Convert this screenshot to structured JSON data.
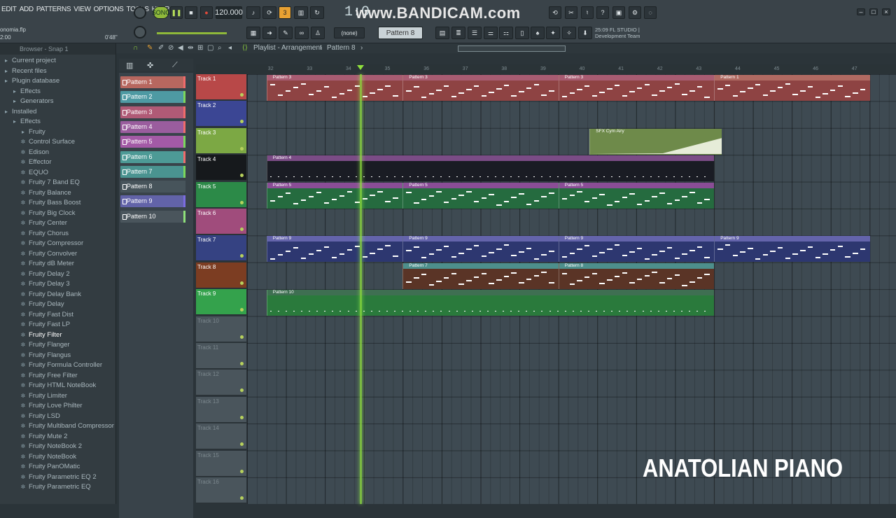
{
  "menu": [
    "EDIT",
    "ADD",
    "PATTERNS",
    "VIEW",
    "OPTIONS",
    "TOOLS",
    "HELP"
  ],
  "transport": {
    "mode": "SONG",
    "tempo": "120.000",
    "time": "1:0"
  },
  "recording_watermark": "www.BANDICAM.com",
  "project": {
    "file": "onomia.flp",
    "time_left": "2:00",
    "time_right": "0'48\""
  },
  "toolbar": {
    "snap": "(none)",
    "pattern": "Pattern 8",
    "hint_line1": "25:09  FL STUDIO |",
    "hint_line2": "Development Team"
  },
  "sidebar": {
    "header": "Browser - Snap 1",
    "items": [
      {
        "label": "Current project",
        "icon": "folder-icon",
        "indent": 0
      },
      {
        "label": "Recent files",
        "icon": "folder-icon",
        "indent": 0
      },
      {
        "label": "Plugin database",
        "icon": "folder-icon",
        "indent": 0
      },
      {
        "label": "Effects",
        "icon": "folder-icon",
        "indent": 1
      },
      {
        "label": "Generators",
        "icon": "folder-icon",
        "indent": 1
      },
      {
        "label": "Installed",
        "icon": "folder-icon",
        "indent": 0
      },
      {
        "label": "Effects",
        "icon": "folder-icon",
        "indent": 1
      },
      {
        "label": "Fruity",
        "icon": "folder-icon",
        "indent": 2
      },
      {
        "label": "Control Surface",
        "icon": "plugin-icon",
        "indent": 2
      },
      {
        "label": "Edison",
        "icon": "plugin-icon",
        "indent": 2
      },
      {
        "label": "Effector",
        "icon": "plugin-icon",
        "indent": 2
      },
      {
        "label": "EQUO",
        "icon": "plugin-icon",
        "indent": 2
      },
      {
        "label": "Fruity 7 Band EQ",
        "icon": "plugin-icon",
        "indent": 2
      },
      {
        "label": "Fruity Balance",
        "icon": "plugin-icon",
        "indent": 2
      },
      {
        "label": "Fruity Bass Boost",
        "icon": "plugin-icon",
        "indent": 2
      },
      {
        "label": "Fruity Big Clock",
        "icon": "plugin-icon",
        "indent": 2
      },
      {
        "label": "Fruity Center",
        "icon": "plugin-icon",
        "indent": 2
      },
      {
        "label": "Fruity Chorus",
        "icon": "plugin-icon",
        "indent": 2
      },
      {
        "label": "Fruity Compressor",
        "icon": "plugin-icon",
        "indent": 2
      },
      {
        "label": "Fruity Convolver",
        "icon": "plugin-icon",
        "indent": 2
      },
      {
        "label": "Fruity dB Meter",
        "icon": "plugin-icon",
        "indent": 2
      },
      {
        "label": "Fruity Delay 2",
        "icon": "plugin-icon",
        "indent": 2
      },
      {
        "label": "Fruity Delay 3",
        "icon": "plugin-icon",
        "indent": 2
      },
      {
        "label": "Fruity Delay Bank",
        "icon": "plugin-icon",
        "indent": 2
      },
      {
        "label": "Fruity Delay",
        "icon": "plugin-icon",
        "indent": 2
      },
      {
        "label": "Fruity Fast Dist",
        "icon": "plugin-icon",
        "indent": 2
      },
      {
        "label": "Fruity Fast LP",
        "icon": "plugin-icon",
        "indent": 2
      },
      {
        "label": "Fruity Filter",
        "icon": "plugin-icon",
        "indent": 2,
        "selected": true
      },
      {
        "label": "Fruity Flanger",
        "icon": "plugin-icon",
        "indent": 2
      },
      {
        "label": "Fruity Flangus",
        "icon": "plugin-icon",
        "indent": 2
      },
      {
        "label": "Fruity Formula Controller",
        "icon": "plugin-icon",
        "indent": 2
      },
      {
        "label": "Fruity Free Filter",
        "icon": "plugin-icon",
        "indent": 2
      },
      {
        "label": "Fruity HTML NoteBook",
        "icon": "plugin-icon",
        "indent": 2
      },
      {
        "label": "Fruity Limiter",
        "icon": "plugin-icon",
        "indent": 2
      },
      {
        "label": "Fruity Love Philter",
        "icon": "plugin-icon",
        "indent": 2
      },
      {
        "label": "Fruity LSD",
        "icon": "plugin-icon",
        "indent": 2
      },
      {
        "label": "Fruity Multiband Compressor",
        "icon": "plugin-icon",
        "indent": 2
      },
      {
        "label": "Fruity Mute 2",
        "icon": "plugin-icon",
        "indent": 2
      },
      {
        "label": "Fruity NoteBook 2",
        "icon": "plugin-icon",
        "indent": 2
      },
      {
        "label": "Fruity NoteBook",
        "icon": "plugin-icon",
        "indent": 2
      },
      {
        "label": "Fruity PanOMatic",
        "icon": "plugin-icon",
        "indent": 2
      },
      {
        "label": "Fruity Parametric EQ 2",
        "icon": "plugin-icon",
        "indent": 2
      },
      {
        "label": "Fruity Parametric EQ",
        "icon": "plugin-icon",
        "indent": 2
      }
    ]
  },
  "playlist": {
    "title": "Playlist - Arrangement",
    "current_pattern": "Pattern 8",
    "ruler": [
      "32",
      "33",
      "34",
      "35",
      "36",
      "37",
      "38",
      "39",
      "40",
      "41",
      "42",
      "43",
      "44",
      "45",
      "46",
      "47"
    ],
    "patterns": [
      {
        "name": "Pattern 1",
        "color": "#b7675f"
      },
      {
        "name": "Pattern 2",
        "color": "#4e9aa3"
      },
      {
        "name": "Pattern 3",
        "color": "#b05a76"
      },
      {
        "name": "Pattern 4",
        "color": "#9a5d9e"
      },
      {
        "name": "Pattern 5",
        "color": "#a35aa6"
      },
      {
        "name": "Pattern 6",
        "color": "#4d9a96"
      },
      {
        "name": "Pattern 7",
        "color": "#4a9390"
      },
      {
        "name": "Pattern 8",
        "color": "#47545b"
      },
      {
        "name": "Pattern 9",
        "color": "#6263a8"
      },
      {
        "name": "Pattern 10",
        "color": "#4a555c"
      }
    ],
    "tracks": [
      {
        "name": "Track 1",
        "color": "#b84848"
      },
      {
        "name": "Track 2",
        "color": "#3b4694"
      },
      {
        "name": "Track 3",
        "color": "#7ca844"
      },
      {
        "name": "Track 4",
        "color": "#16191c"
      },
      {
        "name": "Track 5",
        "color": "#2c8a48"
      },
      {
        "name": "Track 6",
        "color": "#a04c7c"
      },
      {
        "name": "Track 7",
        "color": "#354282"
      },
      {
        "name": "Track 8",
        "color": "#7c3d22"
      },
      {
        "name": "Track 9",
        "color": "#34a24c"
      },
      {
        "name": "Track 10",
        "color": "#4a555c"
      },
      {
        "name": "Track 11",
        "color": "#4a555c"
      },
      {
        "name": "Track 12",
        "color": "#4a555c"
      },
      {
        "name": "Track 13",
        "color": "#4a555c"
      },
      {
        "name": "Track 14",
        "color": "#4a555c"
      },
      {
        "name": "Track 15",
        "color": "#4a555c"
      },
      {
        "name": "Track 16",
        "color": "#4a555c"
      }
    ],
    "clips": [
      {
        "track": 0,
        "start": 32,
        "len": 3.5,
        "label": "Pattern 3",
        "color": "#8e4343",
        "head": "#a85c72"
      },
      {
        "track": 0,
        "start": 35.5,
        "len": 4,
        "label": "Pattern 3",
        "color": "#8e4343",
        "head": "#a85c72"
      },
      {
        "track": 0,
        "start": 39.5,
        "len": 4,
        "label": "Pattern 3",
        "color": "#8e4343",
        "head": "#a85c72"
      },
      {
        "track": 0,
        "start": 43.5,
        "len": 4,
        "label": "Pattern 1",
        "color": "#8e4343",
        "head": "#b06a62"
      },
      {
        "track": 2,
        "start": 40.3,
        "len": 3.4,
        "label": "SFX Cym Airy",
        "color": "#6e8a4a",
        "head": "#6e8a4a"
      },
      {
        "track": 3,
        "start": 32,
        "len": 11.5,
        "label": "Pattern 4",
        "color": "#1a1c24",
        "head": "#7b4c86"
      },
      {
        "track": 4,
        "start": 32,
        "len": 3.5,
        "label": "Pattern 5",
        "color": "#256b3f",
        "head": "#8a4d96"
      },
      {
        "track": 4,
        "start": 35.5,
        "len": 4,
        "label": "Pattern 5",
        "color": "#256b3f",
        "head": "#8a4d96"
      },
      {
        "track": 4,
        "start": 39.5,
        "len": 4,
        "label": "Pattern 5",
        "color": "#256b3f",
        "head": "#8a4d96"
      },
      {
        "track": 6,
        "start": 32,
        "len": 3.5,
        "label": "Pattern 9",
        "color": "#2d3770",
        "head": "#6464ab"
      },
      {
        "track": 6,
        "start": 35.5,
        "len": 4,
        "label": "Pattern 9",
        "color": "#2d3770",
        "head": "#6464ab"
      },
      {
        "track": 6,
        "start": 39.5,
        "len": 4,
        "label": "Pattern 9",
        "color": "#2d3770",
        "head": "#6464ab"
      },
      {
        "track": 6,
        "start": 43.5,
        "len": 4,
        "label": "Pattern 9",
        "color": "#2d3770",
        "head": "#6464ab"
      },
      {
        "track": 7,
        "start": 35.5,
        "len": 4,
        "label": "Pattern 7",
        "color": "#5a3426",
        "head": "#4d8f8c"
      },
      {
        "track": 7,
        "start": 39.5,
        "len": 4,
        "label": "Pattern 8",
        "color": "#5a3426",
        "head": "#4d8f8c"
      },
      {
        "track": 8,
        "start": 32,
        "len": 11.5,
        "label": "Pattern 10",
        "color": "#2a7a3c",
        "head": "#3f6f52"
      }
    ],
    "playhead_bar": 34.4
  },
  "overlay_text": "ANATOLIAN PIANO"
}
